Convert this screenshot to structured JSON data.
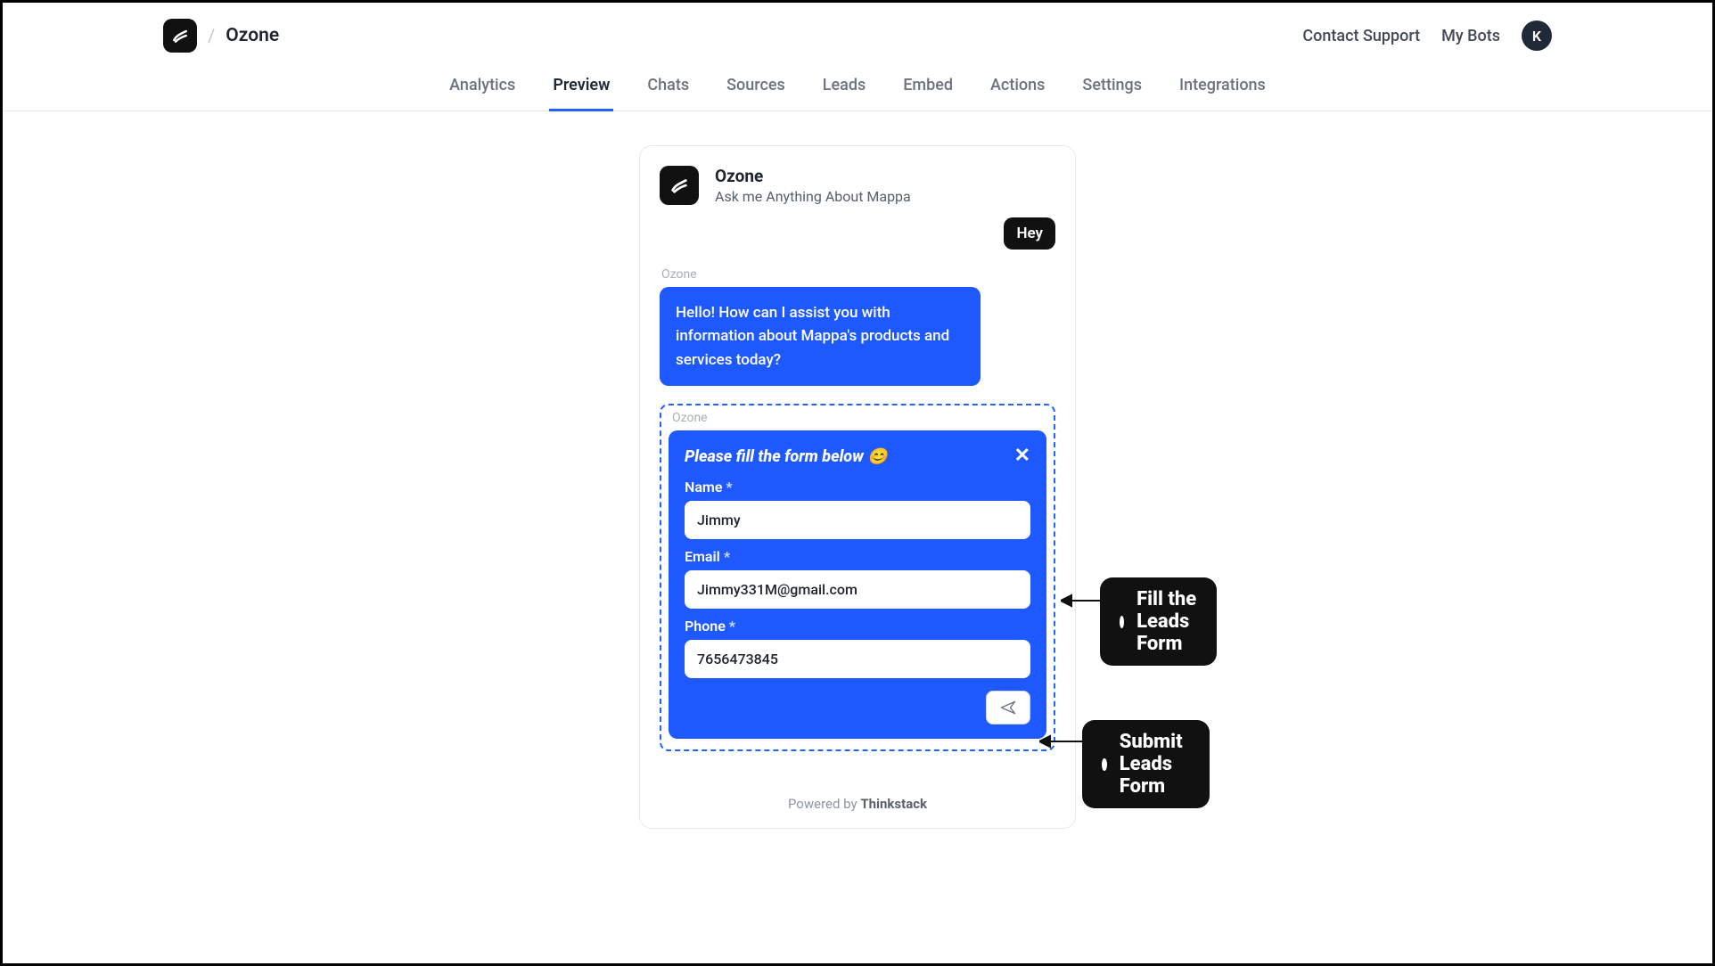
{
  "header": {
    "title": "Ozone",
    "contact_label": "Contact Support",
    "my_bots_label": "My Bots",
    "avatar_letter": "K"
  },
  "tabs": {
    "items": [
      {
        "label": "Analytics",
        "active": false
      },
      {
        "label": "Preview",
        "active": true
      },
      {
        "label": "Chats",
        "active": false
      },
      {
        "label": "Sources",
        "active": false
      },
      {
        "label": "Leads",
        "active": false
      },
      {
        "label": "Embed",
        "active": false
      },
      {
        "label": "Actions",
        "active": false
      },
      {
        "label": "Settings",
        "active": false
      },
      {
        "label": "Integrations",
        "active": false
      }
    ]
  },
  "chat": {
    "title": "Ozone",
    "subtitle": "Ask me Anything About Mappa",
    "user_message": "Hey",
    "sender_label": "Ozone",
    "bot_message": "Hello! How can I assist you with information about Mappa's products and services today?"
  },
  "form": {
    "sender_label": "Ozone",
    "title": "Please fill the form below 😊",
    "fields": {
      "name": {
        "label": "Name",
        "value": "Jimmy"
      },
      "email": {
        "label": "Email",
        "value": "Jimmy331M@gmail.com"
      },
      "phone": {
        "label": "Phone",
        "value": "7656473845"
      }
    }
  },
  "footer": {
    "prefix": "Powered by ",
    "brand": "Thinkstack"
  },
  "callouts": {
    "fill": "Fill the Leads Form",
    "submit": "Submit Leads Form"
  }
}
